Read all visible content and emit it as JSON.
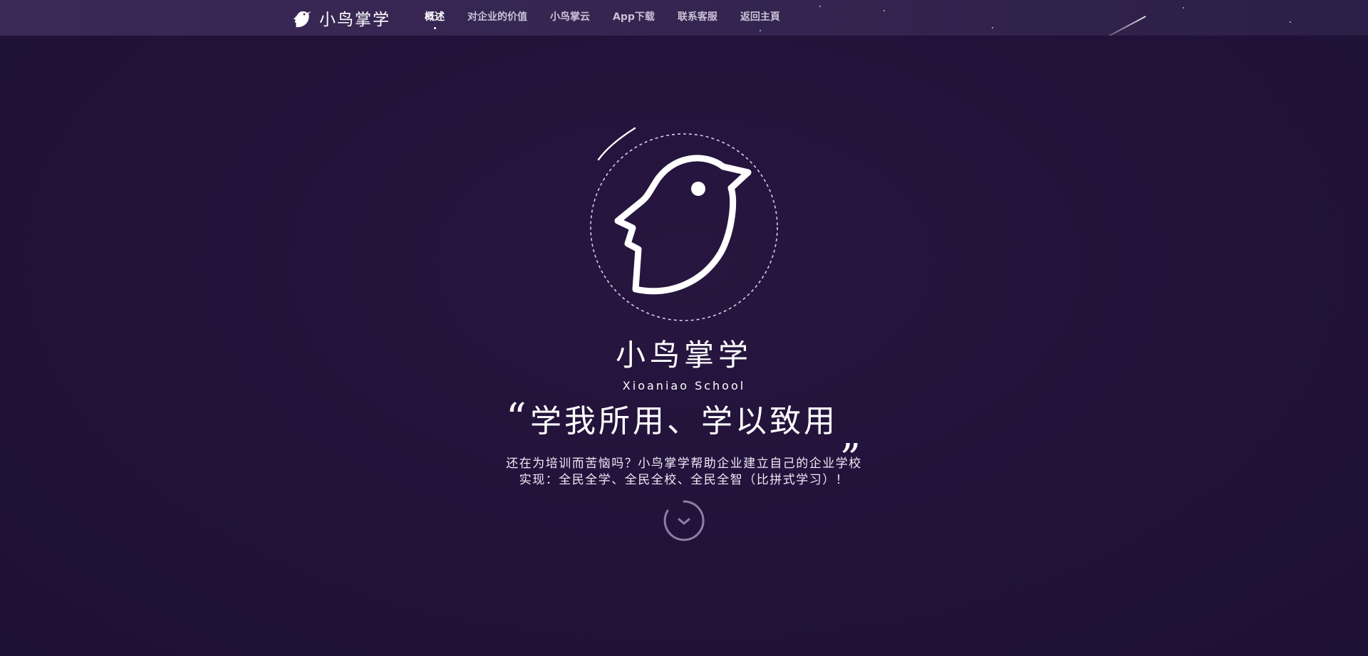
{
  "header": {
    "brand_name": "小鸟掌学",
    "brand_icon": "bird-logo-icon",
    "nav": [
      {
        "label": "概述",
        "active": true
      },
      {
        "label": "对企业的价值",
        "active": false
      },
      {
        "label": "小鸟掌云",
        "active": false
      },
      {
        "label": "App下载",
        "active": false
      },
      {
        "label": "联系客服",
        "active": false
      },
      {
        "label": "返回主頁",
        "active": false
      }
    ]
  },
  "hero": {
    "logo_icon": "bird-logo-icon",
    "title": "小鸟掌学",
    "subtitle": "Xioaniao School",
    "slogan": "学我所用、学以致用",
    "quote_open": "“",
    "quote_close": "„",
    "description": [
      "还在为培训而苦恼吗？小鸟掌学帮助企业建立自己的企业学校",
      "实现：全民全学、全民全校、全民全智（比拼式学习）！"
    ],
    "scroll_icon": "chevron-down-icon"
  },
  "colors": {
    "background": "#22133a",
    "header_bar": "#3a2856",
    "text": "#ffffff",
    "nav_inactive": "#c9c1d6"
  }
}
